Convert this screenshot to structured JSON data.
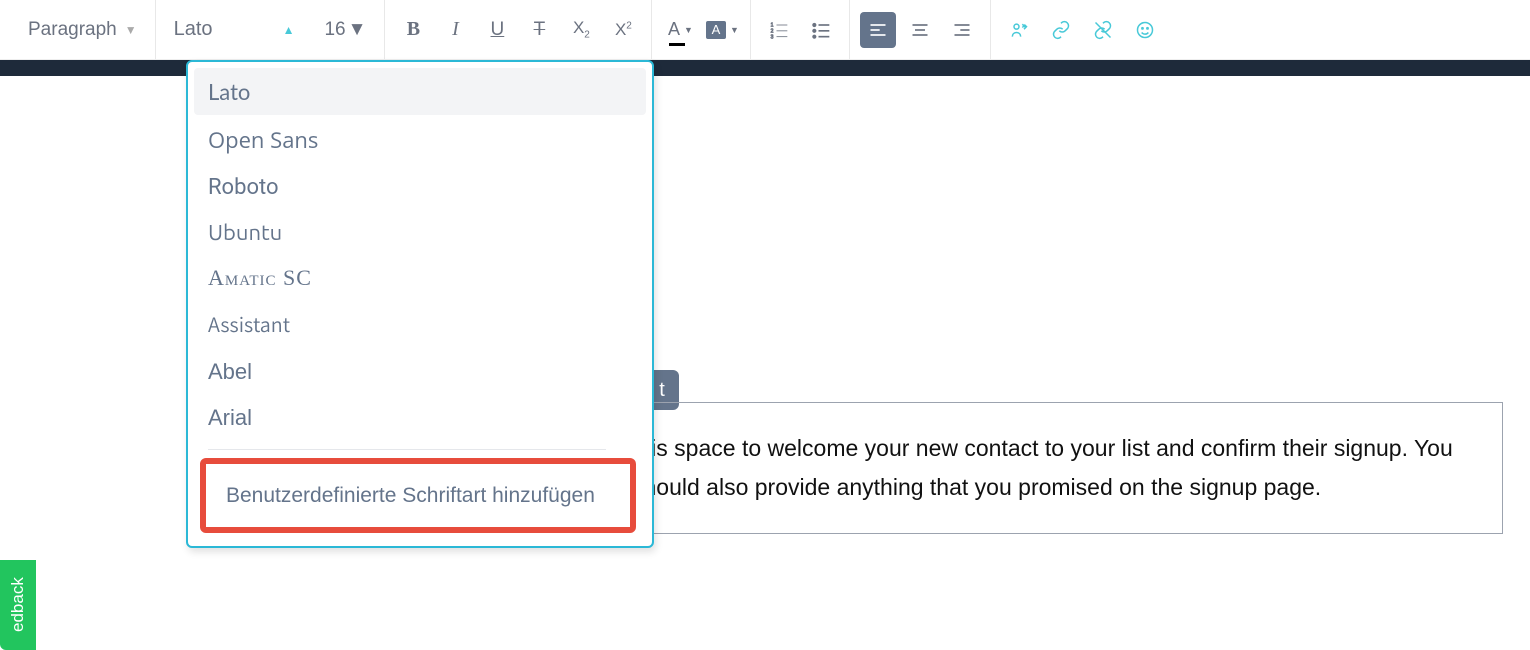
{
  "toolbar": {
    "paragraph_label": "Paragraph",
    "font_label": "Lato",
    "size_label": "16"
  },
  "font_dropdown": {
    "items": [
      {
        "label": "Lato",
        "font": "Lato, sans-serif",
        "selected": true
      },
      {
        "label": "Open Sans",
        "font": "'Open Sans', sans-serif"
      },
      {
        "label": "Roboto",
        "font": "Roboto, sans-serif"
      },
      {
        "label": "Ubuntu",
        "font": "Ubuntu, sans-serif"
      },
      {
        "label": "Amatic SC",
        "font": "'Amatic SC', cursive",
        "style": "font-variant:small-caps; letter-spacing:1px; font-family:serif;"
      },
      {
        "label": "Assistant",
        "font": "Assistant, sans-serif"
      },
      {
        "label": "Abel",
        "font": "Abel, sans-serif",
        "style": "font-family: 'Arial Narrow', sans-serif;"
      },
      {
        "label": "Arial",
        "font": "Arial, sans-serif"
      }
    ],
    "add_custom": "Benutzerdefinierte Schriftart hinzufügen"
  },
  "content": {
    "t_label": "t",
    "body_text": "this space to welcome your new contact to your list and confirm their signup. You should also provide anything that you promised on the signup page."
  },
  "feedback": {
    "label": "edback"
  },
  "colors": {
    "accent": "#2bb8d6",
    "highlight": "#e74c3c",
    "toolbar_icon": "#6b7280",
    "teal": "#48c9d8"
  }
}
